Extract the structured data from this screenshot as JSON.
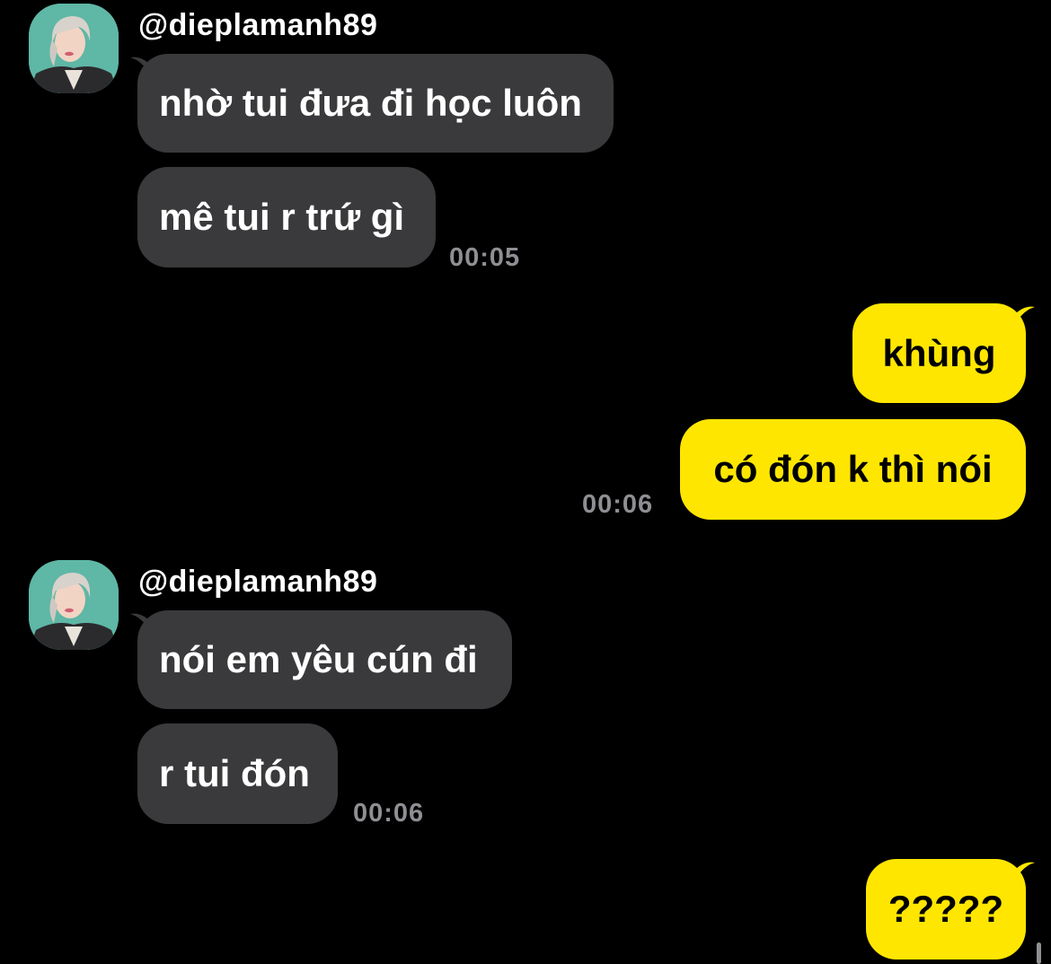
{
  "colors": {
    "background": "#000000",
    "incoming_bubble": "#3a3a3c",
    "outgoing_bubble": "#ffe600",
    "timestamp": "#8e8e93"
  },
  "groups": [
    {
      "direction": "incoming",
      "sender": "@dieplamanh89",
      "messages": [
        "nhờ tui đưa đi học luôn",
        "mê tui r trứ gì"
      ],
      "time": "00:05"
    },
    {
      "direction": "outgoing",
      "messages": [
        "khùng",
        "có đón k thì nói"
      ],
      "time": "00:06"
    },
    {
      "direction": "incoming",
      "sender": "@dieplamanh89",
      "messages": [
        "nói em yêu cún đi",
        "r tui đón"
      ],
      "time": "00:06"
    },
    {
      "direction": "outgoing",
      "messages": [
        "?????"
      ]
    }
  ]
}
